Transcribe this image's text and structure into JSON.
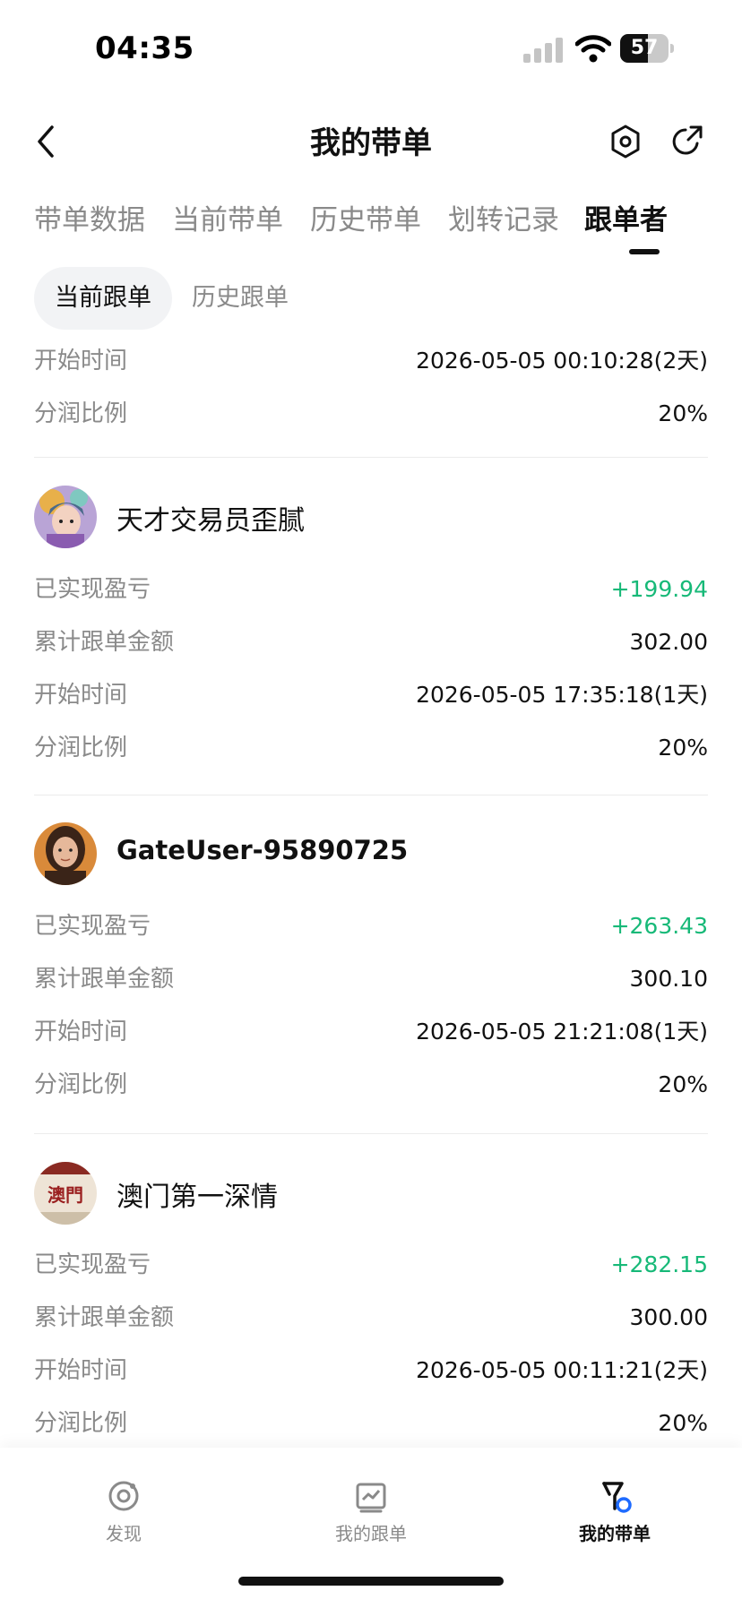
{
  "status_bar": {
    "time": "04:35",
    "battery": "57",
    "battery_level": 0.57
  },
  "header": {
    "title": "我的带单"
  },
  "main_tabs": [
    "带单数据",
    "当前带单",
    "历史带单",
    "划转记录",
    "跟单者"
  ],
  "active_main_tab": "跟单者",
  "sub_tabs": {
    "active": "当前跟单",
    "inactive": "历史跟单"
  },
  "labels": {
    "realized_pnl": "已实现盈亏",
    "total_amount": "累计跟单金额",
    "start_time": "开始时间",
    "profit_share": "分润比例"
  },
  "partial_entry": {
    "start_time": "2026-05-05 00:10:28(2天)",
    "profit_share": "20%"
  },
  "followers": [
    {
      "name": "天才交易员歪腻",
      "avatar": "anime-avatar",
      "realized_pnl": "+199.94",
      "total_amount": "302.00",
      "start_time": "2026-05-05 17:35:18(1天)",
      "profit_share": "20%"
    },
    {
      "name": "GateUser-95890725",
      "avatar": "woman-portrait-avatar",
      "realized_pnl": "+263.43",
      "total_amount": "300.10",
      "start_time": "2026-05-05 21:21:08(1天)",
      "profit_share": "20%"
    },
    {
      "name": "澳门第一深情",
      "avatar": "macau-cafe-logo-avatar",
      "avatar_text": "澳門",
      "realized_pnl": "+282.15",
      "total_amount": "300.00",
      "start_time": "2026-05-05 00:11:21(2天)",
      "profit_share": "20%"
    }
  ],
  "bottom_nav": [
    {
      "label": "发现",
      "icon": "discover-icon",
      "active": false
    },
    {
      "label": "我的跟单",
      "icon": "my-follow-icon",
      "active": false
    },
    {
      "label": "我的带单",
      "icon": "my-lead-icon",
      "active": true
    }
  ],
  "colors": {
    "positive": "#17b978",
    "muted_text": "#8a8a8a",
    "primary_text": "#111111",
    "accent_blue": "#1e6bff"
  }
}
